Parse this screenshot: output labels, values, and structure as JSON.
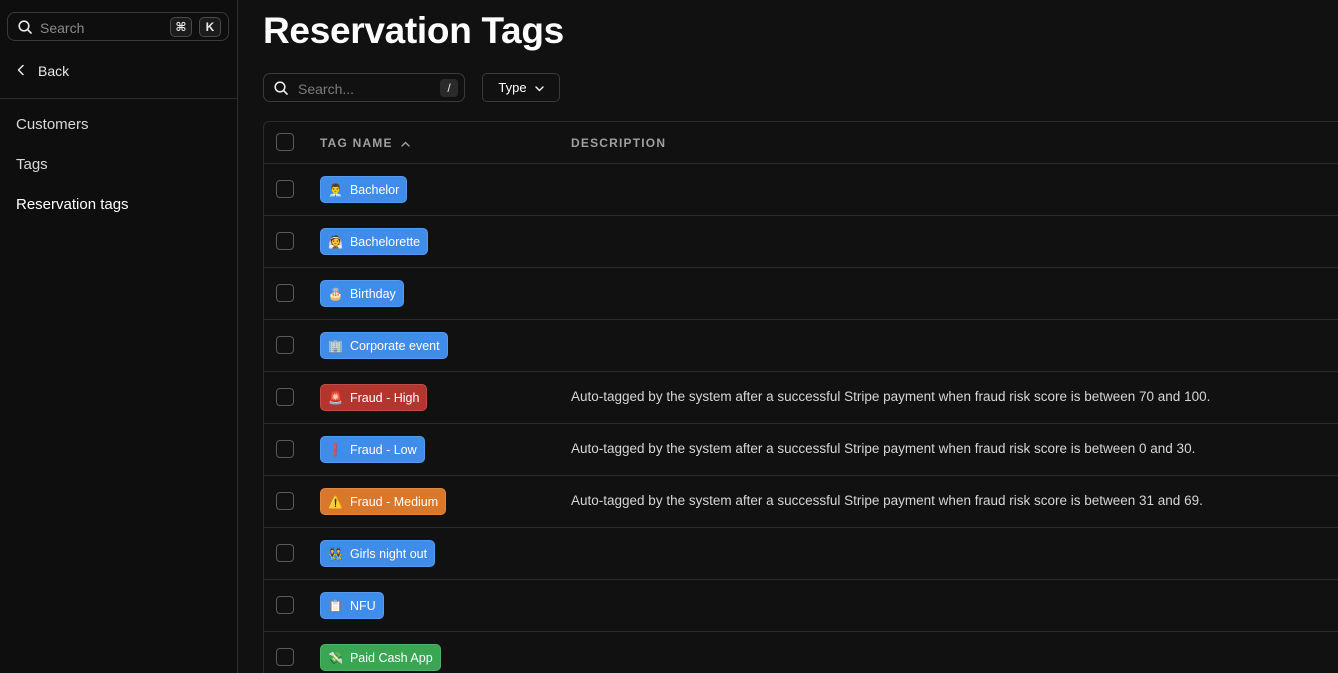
{
  "sidebar": {
    "search_placeholder": "Search",
    "shortcut_cmd": "⌘",
    "shortcut_key": "K",
    "back_label": "Back",
    "nav": [
      {
        "label": "Customers",
        "active": false
      },
      {
        "label": "Tags",
        "active": false
      },
      {
        "label": "Reservation tags",
        "active": true
      }
    ]
  },
  "main": {
    "title": "Reservation Tags",
    "search_placeholder": "Search...",
    "search_shortcut": "/",
    "type_filter_label": "Type",
    "columns": {
      "tag_name": "TAG NAME",
      "description": "DESCRIPTION"
    },
    "rows": [
      {
        "emoji": "👨‍💼",
        "name": "Bachelor",
        "color": "#3f8cea",
        "description": ""
      },
      {
        "emoji": "👰",
        "name": "Bachelorette",
        "color": "#3f8cea",
        "description": ""
      },
      {
        "emoji": "🎂",
        "name": "Birthday",
        "color": "#3f8cea",
        "description": ""
      },
      {
        "emoji": "🏢",
        "name": "Corporate event",
        "color": "#3f8cea",
        "description": ""
      },
      {
        "emoji": "🚨",
        "name": "Fraud - High",
        "color": "#b3362e",
        "description": "Auto-tagged by the system after a successful Stripe payment when fraud risk score is between 70 and 100."
      },
      {
        "emoji": "❗",
        "name": "Fraud - Low",
        "color": "#3f8cea",
        "description": "Auto-tagged by the system after a successful Stripe payment when fraud risk score is between 0 and 30."
      },
      {
        "emoji": "⚠️",
        "name": "Fraud - Medium",
        "color": "#d9772b",
        "description": "Auto-tagged by the system after a successful Stripe payment when fraud risk score is between 31 and 69."
      },
      {
        "emoji": "👯",
        "name": "Girls night out",
        "color": "#3f8cea",
        "description": ""
      },
      {
        "emoji": "📋",
        "name": "NFU",
        "color": "#3f8cea",
        "description": ""
      },
      {
        "emoji": "💸",
        "name": "Paid Cash App",
        "color": "#3aa653",
        "description": ""
      }
    ]
  }
}
